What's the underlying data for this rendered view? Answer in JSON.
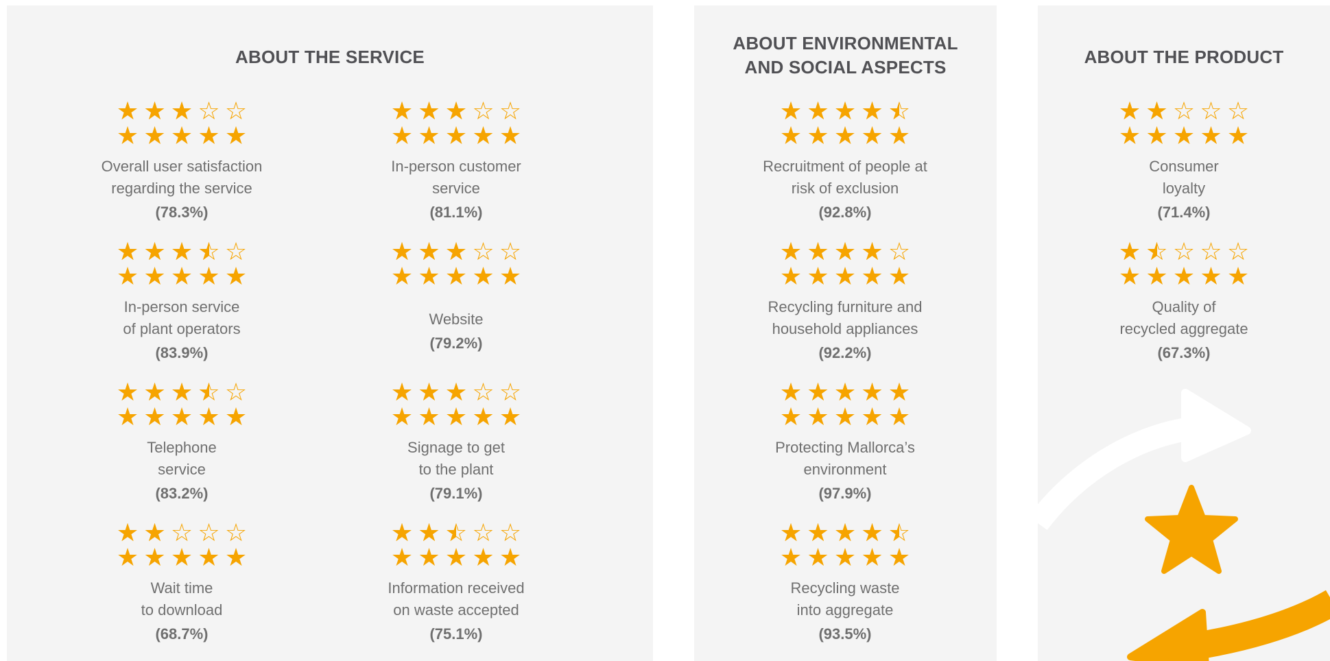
{
  "colors": {
    "star": "#f6a400",
    "panel": "#f4f4f4",
    "title": "#505054",
    "text": "#6f6f6f"
  },
  "icons": {
    "filled_star": "star-icon",
    "empty_star": "empty-star-icon",
    "arrow": "circular-arrow-icon",
    "big_star": "big-star-icon"
  },
  "sections": {
    "service": {
      "title": "ABOUT THE SERVICE",
      "items": [
        {
          "label_lines": [
            "Overall user satisfaction",
            "regarding the service"
          ],
          "percent": "(78.3%)",
          "rating": 3.0,
          "max": 5
        },
        {
          "label_lines": [
            "In-person customer",
            "service"
          ],
          "percent": "(81.1%)",
          "rating": 3.0,
          "max": 5
        },
        {
          "label_lines": [
            "In-person service",
            "of plant operators"
          ],
          "percent": "(83.9%)",
          "rating": 3.5,
          "max": 5
        },
        {
          "label_lines": [
            "Website"
          ],
          "percent": "(79.2%)",
          "rating": 3.0,
          "max": 5
        },
        {
          "label_lines": [
            "Telephone",
            "service"
          ],
          "percent": "(83.2%)",
          "rating": 3.5,
          "max": 5
        },
        {
          "label_lines": [
            "Signage to get",
            "to the plant"
          ],
          "percent": "(79.1%)",
          "rating": 3.0,
          "max": 5
        },
        {
          "label_lines": [
            "Wait time",
            "to download"
          ],
          "percent": "(68.7%)",
          "rating": 2.0,
          "max": 5
        },
        {
          "label_lines": [
            "Information received",
            "on waste accepted"
          ],
          "percent": "(75.1%)",
          "rating": 2.5,
          "max": 5
        }
      ]
    },
    "environment": {
      "title_lines": [
        "ABOUT ENVIRONMENTAL",
        "AND SOCIAL ASPECTS"
      ],
      "items": [
        {
          "label_lines": [
            "Recruitment of people at",
            "risk of exclusion"
          ],
          "percent": "(92.8%)",
          "rating": 4.5,
          "max": 5
        },
        {
          "label_lines": [
            "Recycling furniture and",
            "household appliances"
          ],
          "percent": "(92.2%)",
          "rating": 4.0,
          "max": 5
        },
        {
          "label_lines": [
            "Protecting Mallorca’s",
            "environment"
          ],
          "percent": "(97.9%)",
          "rating": 5.0,
          "max": 5
        },
        {
          "label_lines": [
            "Recycling waste",
            "into aggregate"
          ],
          "percent": "(93.5%)",
          "rating": 4.5,
          "max": 5
        }
      ]
    },
    "product": {
      "title": "ABOUT THE PRODUCT",
      "items": [
        {
          "label_lines": [
            "Consumer",
            "loyalty"
          ],
          "percent": "(71.4%)",
          "rating": 2.0,
          "max": 5
        },
        {
          "label_lines": [
            "Quality of",
            "recycled aggregate"
          ],
          "percent": "(67.3%)",
          "rating": 1.5,
          "max": 5
        }
      ]
    }
  }
}
